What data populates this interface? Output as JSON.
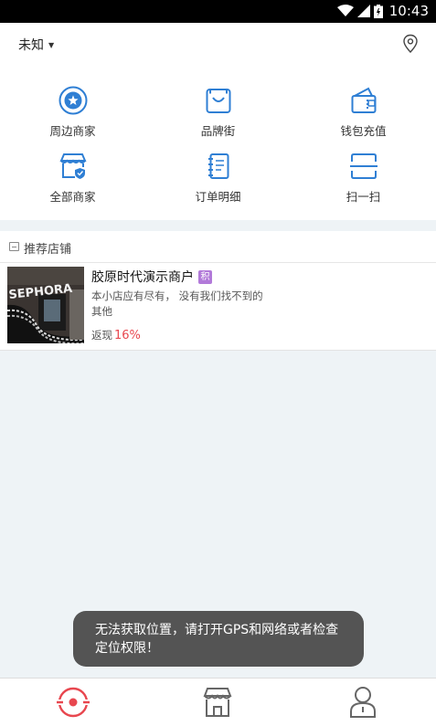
{
  "status_bar": {
    "time": "10:43"
  },
  "header": {
    "location_label": "未知"
  },
  "grid_items": [
    {
      "label": "周边商家",
      "icon": "nearby-merchant-icon"
    },
    {
      "label": "品牌街",
      "icon": "shopping-bag-icon"
    },
    {
      "label": "钱包充值",
      "icon": "wallet-icon"
    },
    {
      "label": "全部商家",
      "icon": "store-icon"
    },
    {
      "label": "订单明细",
      "icon": "order-list-icon"
    },
    {
      "label": "扫一扫",
      "icon": "scan-icon"
    }
  ],
  "recommended": {
    "title": "推荐店铺",
    "shops": [
      {
        "name": "胶原时代演示商户",
        "badge": "积",
        "thumb_text": "SEPHORA",
        "description": "本小店应有尽有， 没有我们找不到的",
        "category": "其他",
        "rebate_label": "返现",
        "rebate_value": "16%"
      }
    ]
  },
  "toast": {
    "message": "无法获取位置，请打开GPS和网络或者检查定位权限！"
  },
  "tabbar": {
    "tabs": [
      {
        "name": "home",
        "icon": "home-target-icon",
        "active": true
      },
      {
        "name": "store",
        "icon": "store-icon",
        "active": false
      },
      {
        "name": "profile",
        "icon": "user-icon",
        "active": false
      }
    ]
  },
  "colors": {
    "accent_blue": "#2f7fd4",
    "active_red": "#e8474f",
    "rebate_red": "#e8474f",
    "badge_purple": "#b27ad9"
  }
}
